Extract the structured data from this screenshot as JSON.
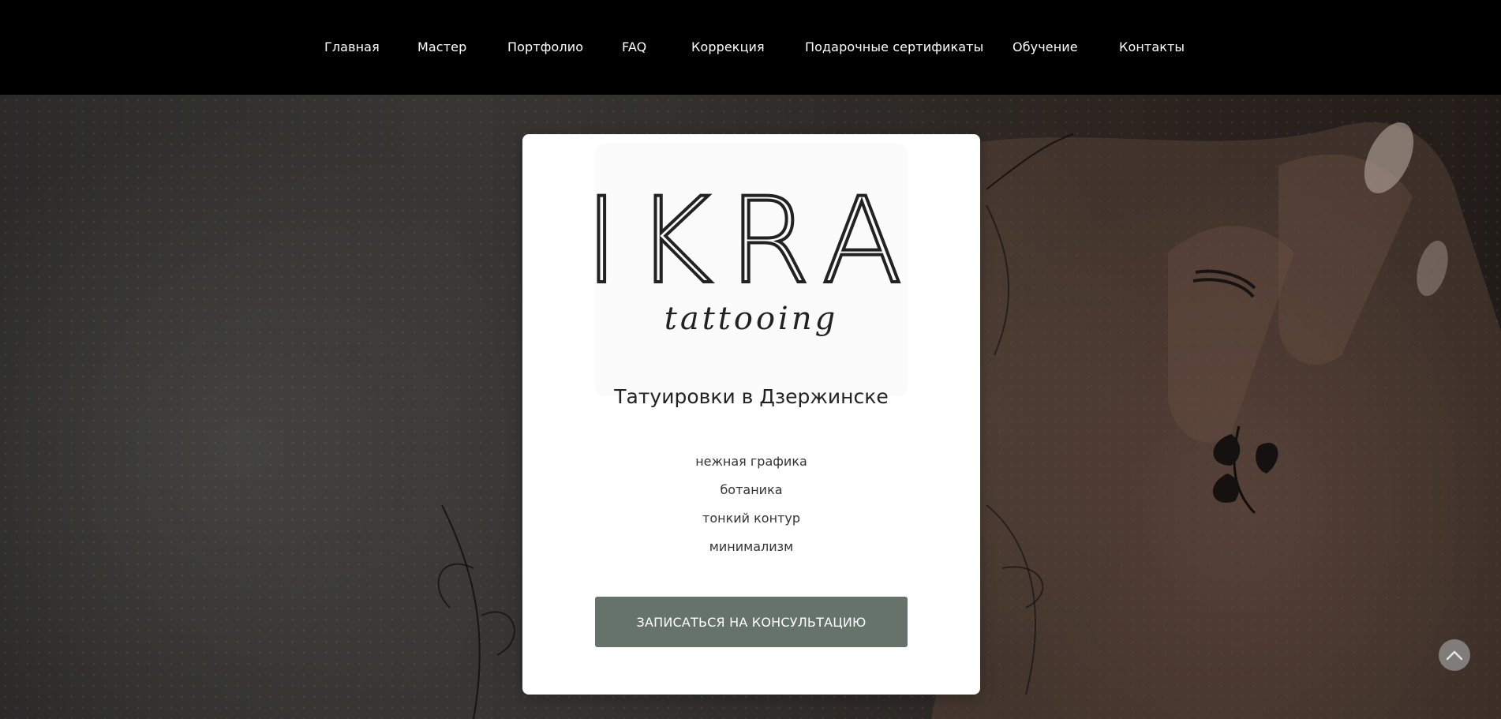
{
  "nav": {
    "items": [
      {
        "label": "Главная"
      },
      {
        "label": "Мастер"
      },
      {
        "label": "Портфолио"
      },
      {
        "label": "FAQ"
      },
      {
        "label": "Коррекция"
      },
      {
        "label": "Подарочные сертификаты"
      },
      {
        "label": "Обучение"
      },
      {
        "label": "Контакты"
      }
    ]
  },
  "logo": {
    "wordmark": "IKRA",
    "script": "tattooing"
  },
  "card": {
    "title": "Татуировки в Дзержинске",
    "features": [
      "нежная графика",
      "ботаника",
      "тонкий контур",
      "минимализм"
    ],
    "cta_label": "ЗАПИСАТЬСЯ НА КОНСУЛЬТАЦИЮ"
  },
  "icons": {
    "scroll_top": "chevron-up-icon"
  },
  "colors": {
    "topbar": "#000000",
    "card": "#ffffff",
    "cta": "#66736a",
    "text": "#222222"
  }
}
